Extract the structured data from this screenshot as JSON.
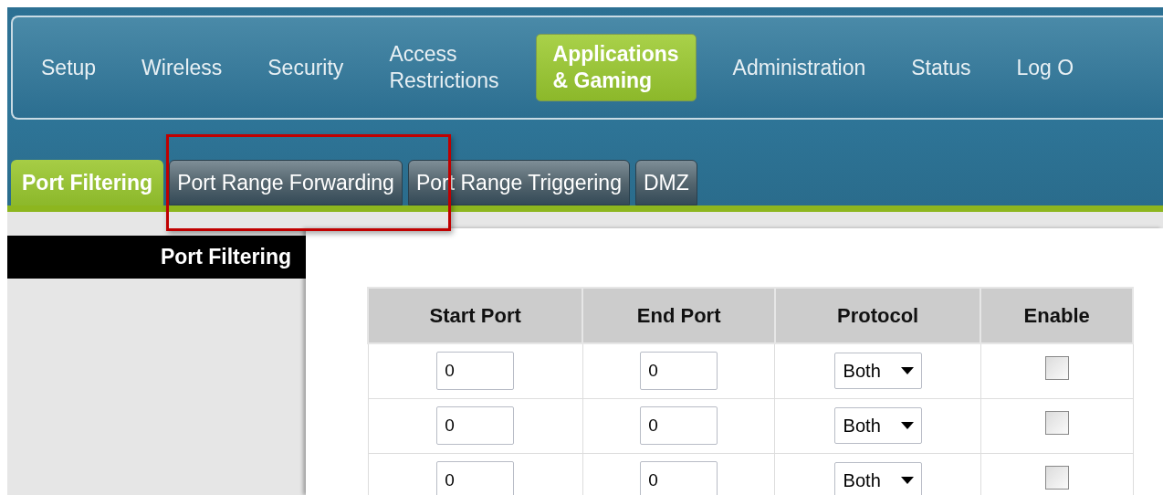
{
  "nav": [
    {
      "label": "Setup",
      "selected": false
    },
    {
      "label": "Wireless",
      "selected": false
    },
    {
      "label": "Security",
      "selected": false
    },
    {
      "label": "Access\nRestrictions",
      "selected": false
    },
    {
      "label": "Applications\n& Gaming",
      "selected": true
    },
    {
      "label": "Administration",
      "selected": false
    },
    {
      "label": "Status",
      "selected": false
    },
    {
      "label": "Log O",
      "selected": false
    }
  ],
  "tabs": [
    {
      "label": "Port Filtering",
      "selected": true
    },
    {
      "label": "Port Range Forwarding",
      "selected": false
    },
    {
      "label": "Port Range Triggering",
      "selected": false
    },
    {
      "label": "DMZ",
      "selected": false
    }
  ],
  "sidebar": {
    "title": "Port Filtering"
  },
  "table": {
    "columns": [
      "Start Port",
      "End Port",
      "Protocol",
      "Enable"
    ],
    "rows": [
      {
        "start_port": "0",
        "end_port": "0",
        "protocol": "Both",
        "enable": false
      },
      {
        "start_port": "0",
        "end_port": "0",
        "protocol": "Both",
        "enable": false
      },
      {
        "start_port": "0",
        "end_port": "0",
        "protocol": "Both",
        "enable": false
      }
    ]
  },
  "annotation": {
    "kind": "highlight"
  }
}
